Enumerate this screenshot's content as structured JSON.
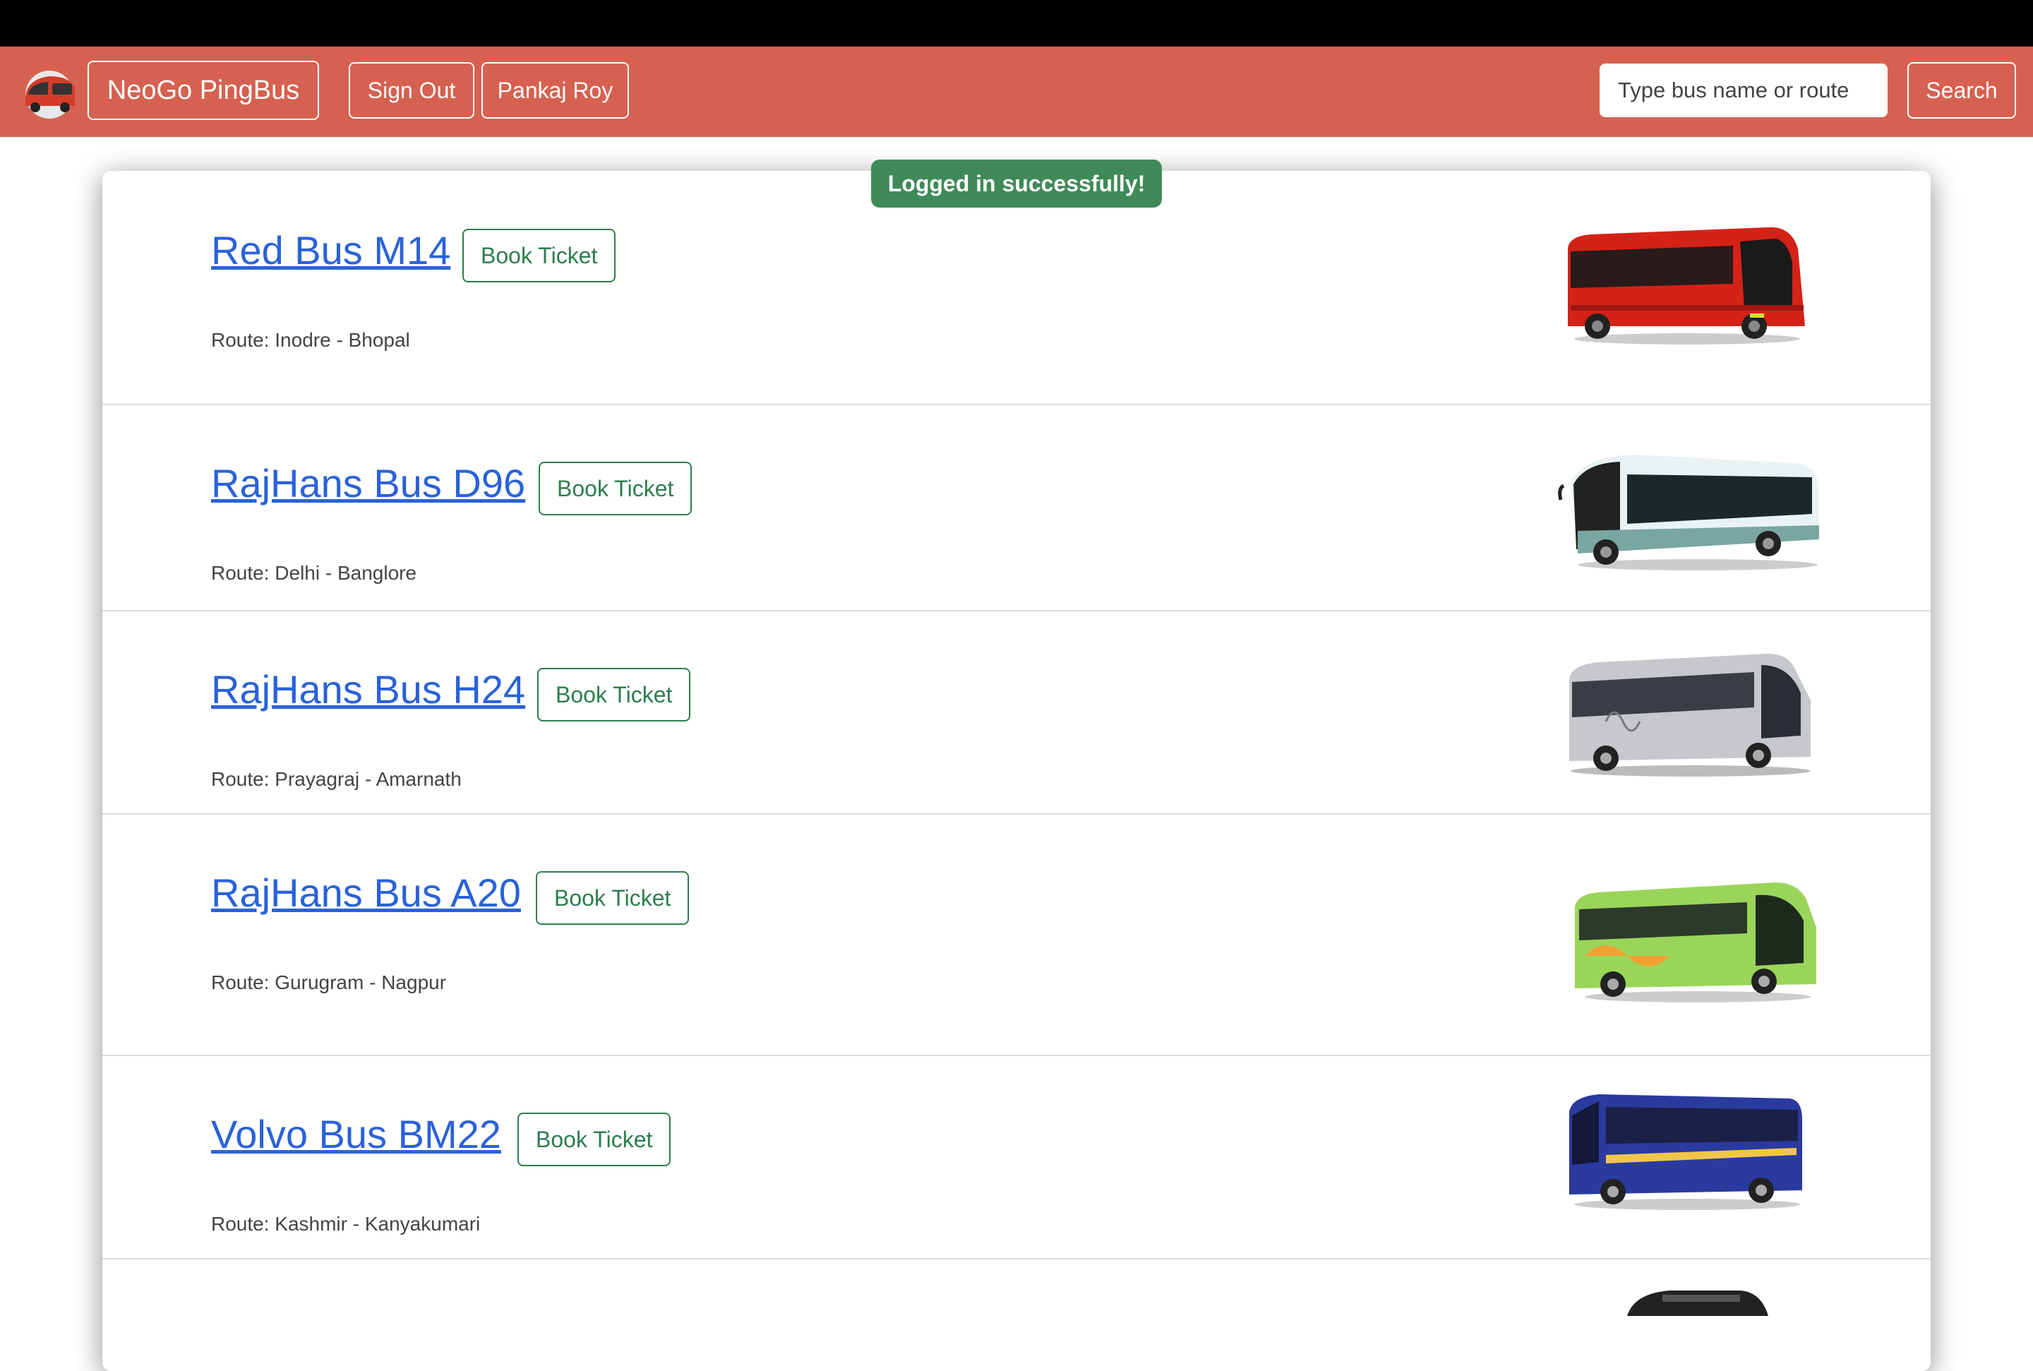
{
  "navbar": {
    "brand": "NeoGo PingBus",
    "sign_out": "Sign Out",
    "user_name": "Pankaj Roy",
    "search_placeholder": "Type bus name or route",
    "search_label": "Search"
  },
  "toast": "Logged in successfully!",
  "buses": [
    {
      "name": "Red Bus M14",
      "book": "Book Ticket",
      "route": "Route: Inodre - Bhopal"
    },
    {
      "name": "RajHans Bus D96",
      "book": "Book Ticket",
      "route": "Route: Delhi - Banglore"
    },
    {
      "name": "RajHans Bus H24",
      "book": "Book Ticket",
      "route": "Route: Prayagraj - Amarnath"
    },
    {
      "name": "RajHans Bus A20",
      "book": "Book Ticket",
      "route": "Route: Gurugram - Nagpur"
    },
    {
      "name": "Volvo Bus BM22",
      "book": "Book Ticket",
      "route": "Route: Kashmir - Kanyakumari"
    }
  ],
  "colors": {
    "navbar": "#d66150",
    "link": "#2a62d8",
    "book_button": "#2e7d4f",
    "toast": "#3f8a58"
  }
}
